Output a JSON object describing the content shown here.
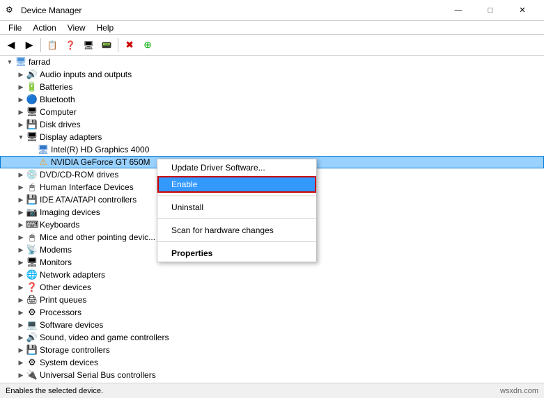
{
  "window": {
    "title": "Device Manager",
    "icon": "⚙"
  },
  "titlebar": {
    "minimize_label": "—",
    "maximize_label": "□",
    "close_label": "✕"
  },
  "menubar": {
    "items": [
      "File",
      "Action",
      "View",
      "Help"
    ]
  },
  "toolbar": {
    "buttons": [
      {
        "name": "back",
        "icon": "◀",
        "label": "Back"
      },
      {
        "name": "forward",
        "icon": "▶",
        "label": "Forward"
      },
      {
        "name": "properties",
        "icon": "📋",
        "label": "Properties"
      },
      {
        "name": "update-driver",
        "icon": "🔄",
        "label": "Update Driver"
      },
      {
        "name": "scan",
        "icon": "🖥",
        "label": "Scan"
      },
      {
        "name": "device-manager",
        "icon": "⚙",
        "label": "Device Manager"
      },
      {
        "name": "remove",
        "icon": "✖",
        "label": "Remove"
      },
      {
        "name": "add",
        "icon": "➕",
        "label": "Add"
      }
    ]
  },
  "tree": {
    "root": {
      "label": "farrad",
      "icon": "🖥"
    },
    "items": [
      {
        "id": "audio",
        "label": "Audio inputs and outputs",
        "icon": "🔊",
        "indent": 1,
        "expanded": false
      },
      {
        "id": "batteries",
        "label": "Batteries",
        "icon": "🔋",
        "indent": 1,
        "expanded": false
      },
      {
        "id": "bluetooth",
        "label": "Bluetooth",
        "icon": "📶",
        "indent": 1,
        "expanded": false
      },
      {
        "id": "computer",
        "label": "Computer",
        "icon": "🖥",
        "indent": 1,
        "expanded": false
      },
      {
        "id": "diskdrives",
        "label": "Disk drives",
        "icon": "💾",
        "indent": 1,
        "expanded": false
      },
      {
        "id": "displayadapters",
        "label": "Display adapters",
        "icon": "🖥",
        "indent": 1,
        "expanded": true
      },
      {
        "id": "intel",
        "label": "Intel(R) HD Graphics 4000",
        "icon": "🖥",
        "indent": 2,
        "expanded": false
      },
      {
        "id": "nvidia",
        "label": "NVIDIA GeForce GT 650M",
        "icon": "⚠",
        "indent": 2,
        "expanded": false,
        "selected": true
      },
      {
        "id": "dvd",
        "label": "DVD/CD-ROM drives",
        "icon": "💿",
        "indent": 1,
        "expanded": false
      },
      {
        "id": "hid",
        "label": "Human Interface Devices",
        "icon": "🖱",
        "indent": 1,
        "expanded": false
      },
      {
        "id": "ide",
        "label": "IDE ATA/ATAPI controllers",
        "icon": "💾",
        "indent": 1,
        "expanded": false
      },
      {
        "id": "imaging",
        "label": "Imaging devices",
        "icon": "📷",
        "indent": 1,
        "expanded": false
      },
      {
        "id": "keyboards",
        "label": "Keyboards",
        "icon": "⌨",
        "indent": 1,
        "expanded": false
      },
      {
        "id": "mice",
        "label": "Mice and other pointing devic...",
        "icon": "🖱",
        "indent": 1,
        "expanded": false
      },
      {
        "id": "modems",
        "label": "Modems",
        "icon": "📡",
        "indent": 1,
        "expanded": false
      },
      {
        "id": "monitors",
        "label": "Monitors",
        "icon": "🖥",
        "indent": 1,
        "expanded": false
      },
      {
        "id": "network",
        "label": "Network adapters",
        "icon": "🌐",
        "indent": 1,
        "expanded": false
      },
      {
        "id": "other",
        "label": "Other devices",
        "icon": "❓",
        "indent": 1,
        "expanded": false
      },
      {
        "id": "printqueues",
        "label": "Print queues",
        "icon": "🖨",
        "indent": 1,
        "expanded": false
      },
      {
        "id": "processors",
        "label": "Processors",
        "icon": "⚙",
        "indent": 1,
        "expanded": false
      },
      {
        "id": "software",
        "label": "Software devices",
        "icon": "💻",
        "indent": 1,
        "expanded": false
      },
      {
        "id": "sound",
        "label": "Sound, video and game controllers",
        "icon": "🔊",
        "indent": 1,
        "expanded": false
      },
      {
        "id": "storage",
        "label": "Storage controllers",
        "icon": "💾",
        "indent": 1,
        "expanded": false
      },
      {
        "id": "system",
        "label": "System devices",
        "icon": "⚙",
        "indent": 1,
        "expanded": false
      },
      {
        "id": "usb",
        "label": "Universal Serial Bus controllers",
        "icon": "🔌",
        "indent": 1,
        "expanded": false
      }
    ]
  },
  "contextmenu": {
    "items": [
      {
        "id": "update-driver",
        "label": "Update Driver Software...",
        "highlighted": false,
        "separator_after": false
      },
      {
        "id": "enable",
        "label": "Enable",
        "highlighted": true,
        "separator_after": true
      },
      {
        "id": "uninstall",
        "label": "Uninstall",
        "highlighted": false,
        "separator_after": true
      },
      {
        "id": "scan",
        "label": "Scan for hardware changes",
        "highlighted": false,
        "separator_after": true
      },
      {
        "id": "properties",
        "label": "Properties",
        "highlighted": false,
        "bold": true,
        "separator_after": false
      }
    ]
  },
  "statusbar": {
    "text": "Enables the selected device.",
    "right": "wsxdn.com"
  }
}
